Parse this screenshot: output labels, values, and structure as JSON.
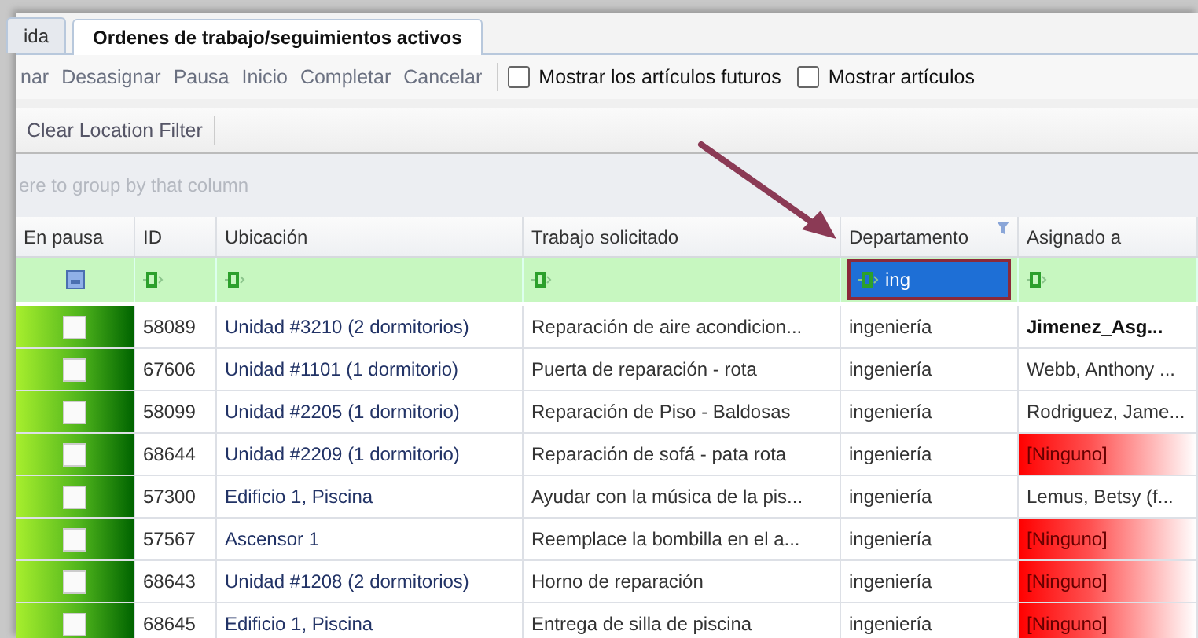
{
  "tabs": [
    {
      "label": "ida",
      "selected": false
    },
    {
      "label": "Ordenes de trabajo/seguimientos activos",
      "selected": true
    }
  ],
  "toolbar": {
    "buttons": [
      {
        "label": "nar",
        "disabled": true
      },
      {
        "label": "Desasignar",
        "disabled": true
      },
      {
        "label": "Pausa",
        "disabled": true
      },
      {
        "label": "Inicio",
        "disabled": true
      },
      {
        "label": "Completar",
        "disabled": true
      },
      {
        "label": "Cancelar",
        "disabled": true
      }
    ],
    "checkboxes": [
      {
        "label": "Mostrar los artículos futuros",
        "checked": false
      },
      {
        "label": "Mostrar artículos",
        "checked": false
      }
    ]
  },
  "location_toolbar": {
    "buttons": [
      {
        "label": "Clear Location Filter"
      }
    ]
  },
  "group_panel": {
    "hint": "ere to group by that column"
  },
  "table": {
    "columns": [
      {
        "label": "En pausa",
        "filtered": false
      },
      {
        "label": "ID",
        "filtered": false
      },
      {
        "label": "Ubicación",
        "filtered": false
      },
      {
        "label": "Trabajo solicitado",
        "filtered": false
      },
      {
        "label": "Departamento",
        "filtered": true
      },
      {
        "label": "Asignado a",
        "filtered": false
      }
    ],
    "filter_row": {
      "department_value": "ing",
      "department_focused": true
    },
    "rows": [
      {
        "paused": false,
        "id": "58089",
        "location": "Unidad #3210 (2 dormitorios)",
        "work": "Reparación de aire acondicion...",
        "department": "ingeniería",
        "assignee": "Jimenez_Asg...",
        "kind": "bold"
      },
      {
        "paused": false,
        "id": "67606",
        "location": "Unidad #1101 (1 dormitorio)",
        "work": "Puerta de reparación - rota",
        "department": "ingeniería",
        "assignee": "Webb, Anthony ...",
        "kind": "normal"
      },
      {
        "paused": false,
        "id": "58099",
        "location": "Unidad #2205 (1 dormitorio)",
        "work": "Reparación de Piso - Baldosas",
        "department": "ingeniería",
        "assignee": "Rodriguez, Jame...",
        "kind": "normal"
      },
      {
        "paused": false,
        "id": "68644",
        "location": "Unidad #2209 (1 dormitorio)",
        "work": "Reparación de sofá - pata rota",
        "department": "ingeniería",
        "assignee": "[Ninguno]",
        "kind": "unassigned"
      },
      {
        "paused": false,
        "id": "57300",
        "location": "Edificio 1, Piscina",
        "work": "Ayudar con la música de la pis...",
        "department": "ingeniería",
        "assignee": "Lemus, Betsy (f...",
        "kind": "normal"
      },
      {
        "paused": false,
        "id": "57567",
        "location": "Ascensor 1",
        "work": "Reemplace la bombilla en el a...",
        "department": "ingeniería",
        "assignee": "[Ninguno]",
        "kind": "unassigned"
      },
      {
        "paused": false,
        "id": "68643",
        "location": "Unidad #1208 (2 dormitorios)",
        "work": "Horno de reparación",
        "department": "ingeniería",
        "assignee": "[Ninguno]",
        "kind": "unassigned"
      },
      {
        "paused": false,
        "id": "68645",
        "location": "Edificio 1, Piscina",
        "work": "Entrega de silla de piscina",
        "department": "ingeniería",
        "assignee": "[Ninguno]",
        "kind": "unassigned"
      }
    ]
  }
}
